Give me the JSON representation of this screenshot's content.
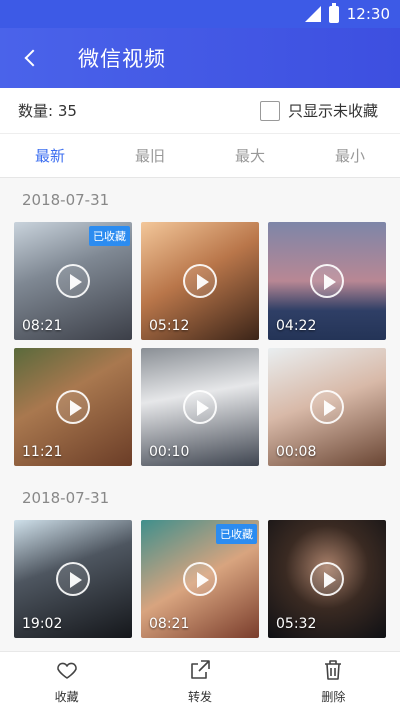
{
  "status": {
    "time": "12:30"
  },
  "header": {
    "title": "微信视频"
  },
  "count_bar": {
    "count_label": "数量: 35",
    "filter_label": "只显示未收藏",
    "filter_checked": false
  },
  "tabs": [
    {
      "label": "最新",
      "active": true
    },
    {
      "label": "最旧",
      "active": false
    },
    {
      "label": "最大",
      "active": false
    },
    {
      "label": "最小",
      "active": false
    }
  ],
  "sections": [
    {
      "date": "2018-07-31",
      "videos": [
        {
          "duration": "08:21",
          "badge": "已收藏"
        },
        {
          "duration": "05:12",
          "badge": ""
        },
        {
          "duration": "04:22",
          "badge": ""
        },
        {
          "duration": "11:21",
          "badge": ""
        },
        {
          "duration": "00:10",
          "badge": ""
        },
        {
          "duration": "00:08",
          "badge": ""
        }
      ]
    },
    {
      "date": "2018-07-31",
      "videos": [
        {
          "duration": "19:02",
          "badge": ""
        },
        {
          "duration": "08:21",
          "badge": "已收藏"
        },
        {
          "duration": "05:32",
          "badge": ""
        }
      ]
    }
  ],
  "actions": [
    {
      "label": "收藏",
      "icon": "heart-icon"
    },
    {
      "label": "转发",
      "icon": "share-icon"
    },
    {
      "label": "删除",
      "icon": "trash-icon"
    }
  ],
  "colors": {
    "primary": "#3d5ae6",
    "accent": "#3d6ff0",
    "badge": "#2c8cf0"
  }
}
